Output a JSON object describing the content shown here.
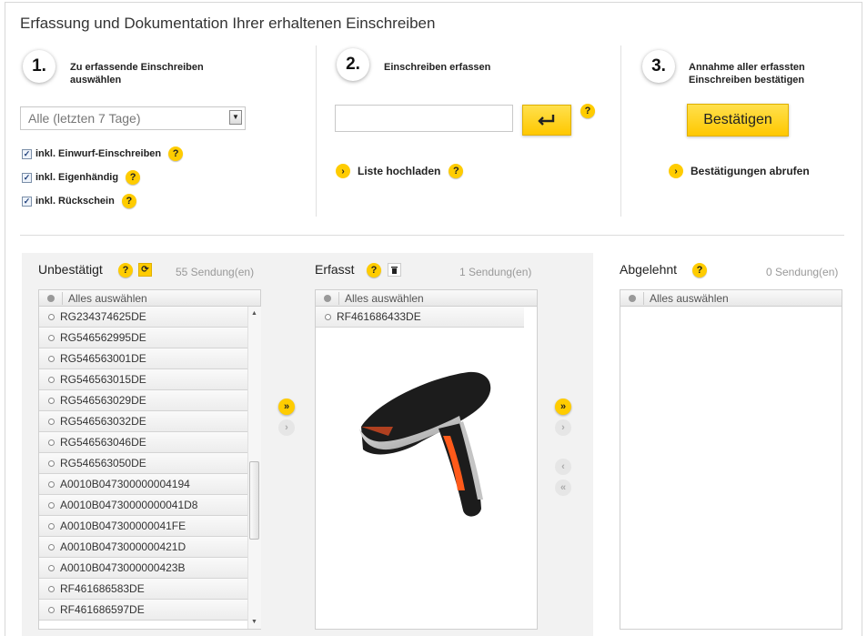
{
  "page": {
    "title": "Erfassung und Dokumentation Ihrer erhaltenen Einschreiben"
  },
  "steps": [
    {
      "number": "1.",
      "label_line1": "Zu erfassende Einschreiben",
      "label_line2": "auswählen"
    },
    {
      "number": "2.",
      "label_line1": "Einschreiben erfassen",
      "label_line2": ""
    },
    {
      "number": "3.",
      "label_line1": "Annahme aller erfassten",
      "label_line2": "Einschreiben bestätigen"
    }
  ],
  "step1": {
    "select_value": "Alle (letzten 7 Tage)",
    "checkboxes": [
      {
        "label": "inkl. Einwurf-Einschreiben",
        "checked": true
      },
      {
        "label": "inkl. Eigenhändig",
        "checked": true
      },
      {
        "label": "inkl. Rückschein",
        "checked": true
      }
    ]
  },
  "step2": {
    "input_value": "",
    "upload_link": "Liste hochladen"
  },
  "step3": {
    "confirm_button": "Bestätigen",
    "retrieve_link": "Bestätigungen abrufen"
  },
  "help_glyph": "?",
  "columns": {
    "unconfirmed": {
      "title": "Unbestätigt",
      "count": "55 Sendung(en)",
      "select_all": "Alles auswählen",
      "items": [
        "RG234374625DE",
        "RG546562995DE",
        "RG546563001DE",
        "RG546563015DE",
        "RG546563029DE",
        "RG546563032DE",
        "RG546563046DE",
        "RG546563050DE",
        "A0010B047300000004194",
        "A0010B04730000000041D8",
        "A0010B047300000041FE",
        "A0010B0473000000421D",
        "A0010B0473000000423B",
        "RF461686583DE",
        "RF461686597DE"
      ]
    },
    "captured": {
      "title": "Erfasst",
      "count": "1 Sendung(en)",
      "select_all": "Alles auswählen",
      "items": [
        "RF461686433DE"
      ]
    },
    "rejected": {
      "title": "Abgelehnt",
      "count": "0 Sendung(en)",
      "select_all": "Alles auswählen",
      "items": []
    }
  },
  "colors": {
    "accent": "#ffcc00",
    "panel_bg": "#f2f2f2"
  },
  "icons": {
    "refresh": "refresh-icon",
    "trash": "trash-icon",
    "enter": "enter-icon",
    "move_all_right": "double-chevron-right-icon",
    "move_right": "chevron-right-icon",
    "move_left": "chevron-left-icon",
    "move_all_left": "double-chevron-left-icon"
  }
}
